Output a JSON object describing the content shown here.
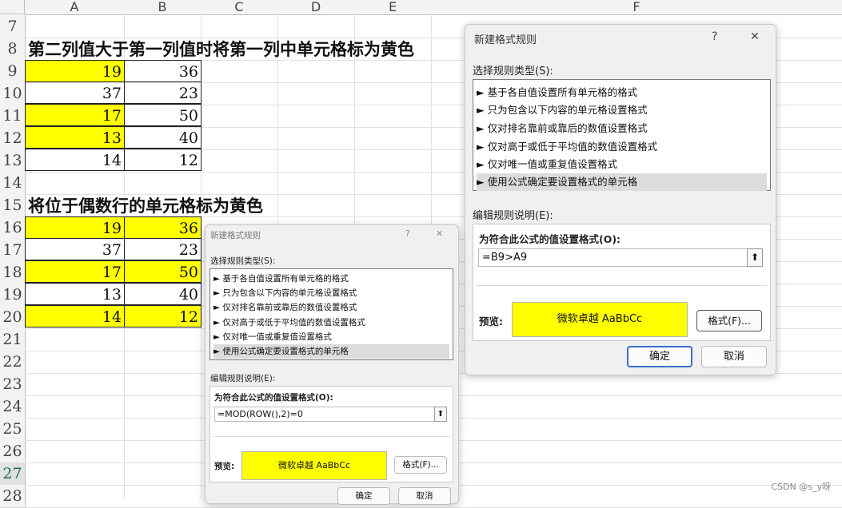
{
  "sheet": {
    "columns": [
      "A",
      "B",
      "C",
      "D",
      "E",
      "F"
    ],
    "rows": [
      "7",
      "8",
      "9",
      "10",
      "11",
      "12",
      "13",
      "14",
      "15",
      "16",
      "17",
      "18",
      "19",
      "20",
      "21",
      "22",
      "23",
      "24",
      "25",
      "26",
      "27",
      "28"
    ],
    "title1": "第二列值大于第一列值时将第一列中单元格标为黄色",
    "title2": "将位于偶数行的单元格标为黄色",
    "table1": [
      {
        "a": "19",
        "b": "36",
        "a_yellow": true,
        "b_yellow": false
      },
      {
        "a": "37",
        "b": "23",
        "a_yellow": false,
        "b_yellow": false
      },
      {
        "a": "17",
        "b": "50",
        "a_yellow": true,
        "b_yellow": false
      },
      {
        "a": "13",
        "b": "40",
        "a_yellow": true,
        "b_yellow": false
      },
      {
        "a": "14",
        "b": "12",
        "a_yellow": false,
        "b_yellow": false
      }
    ],
    "table2": [
      {
        "a": "19",
        "b": "36",
        "a_yellow": true,
        "b_yellow": true
      },
      {
        "a": "37",
        "b": "23",
        "a_yellow": false,
        "b_yellow": false
      },
      {
        "a": "17",
        "b": "50",
        "a_yellow": true,
        "b_yellow": true
      },
      {
        "a": "13",
        "b": "40",
        "a_yellow": false,
        "b_yellow": false
      },
      {
        "a": "14",
        "b": "12",
        "a_yellow": true,
        "b_yellow": true
      }
    ],
    "selected_row": "27",
    "highlight_color": "#ffff00"
  },
  "dialog_large": {
    "title": "新建格式规则",
    "help": "?",
    "close": "✕",
    "rule_type_label": "选择规则类型(S):",
    "rule_types": [
      "► 基于各自值设置所有单元格的格式",
      "► 只为包含以下内容的单元格设置格式",
      "► 仅对排名靠前或靠后的数值设置格式",
      "► 仅对高于或低于平均值的数值设置格式",
      "► 仅对唯一值或重复值设置格式",
      "► 使用公式确定要设置格式的单元格"
    ],
    "edit_label": "编辑规则说明(E):",
    "formula_label": "为符合此公式的值设置格式(O):",
    "formula": "=B9>A9",
    "preview_label": "预览:",
    "preview_text": "微软卓越  AaBbCc",
    "format_button": "格式(F)...",
    "ok": "确定",
    "cancel": "取消"
  },
  "dialog_small": {
    "title": "新建格式规则",
    "help": "?",
    "close": "✕",
    "rule_type_label": "选择规则类型(S):",
    "rule_types": [
      "► 基于各自值设置所有单元格的格式",
      "► 只为包含以下内容的单元格设置格式",
      "► 仅对排名靠前或靠后的数值设置格式",
      "► 仅对高于或低于平均值的数值设置格式",
      "► 仅对唯一值或重复值设置格式",
      "► 使用公式确定要设置格式的单元格"
    ],
    "edit_label": "编辑规则说明(E):",
    "formula_label": "为符合此公式的值设置格式(O):",
    "formula": "=MOD(ROW(),2)=0",
    "preview_label": "预览:",
    "preview_text": "微软卓越  AaBbCc",
    "format_button": "格式(F)...",
    "ok": "确定",
    "cancel": "取消"
  },
  "watermark": "CSDN @s_y呀"
}
